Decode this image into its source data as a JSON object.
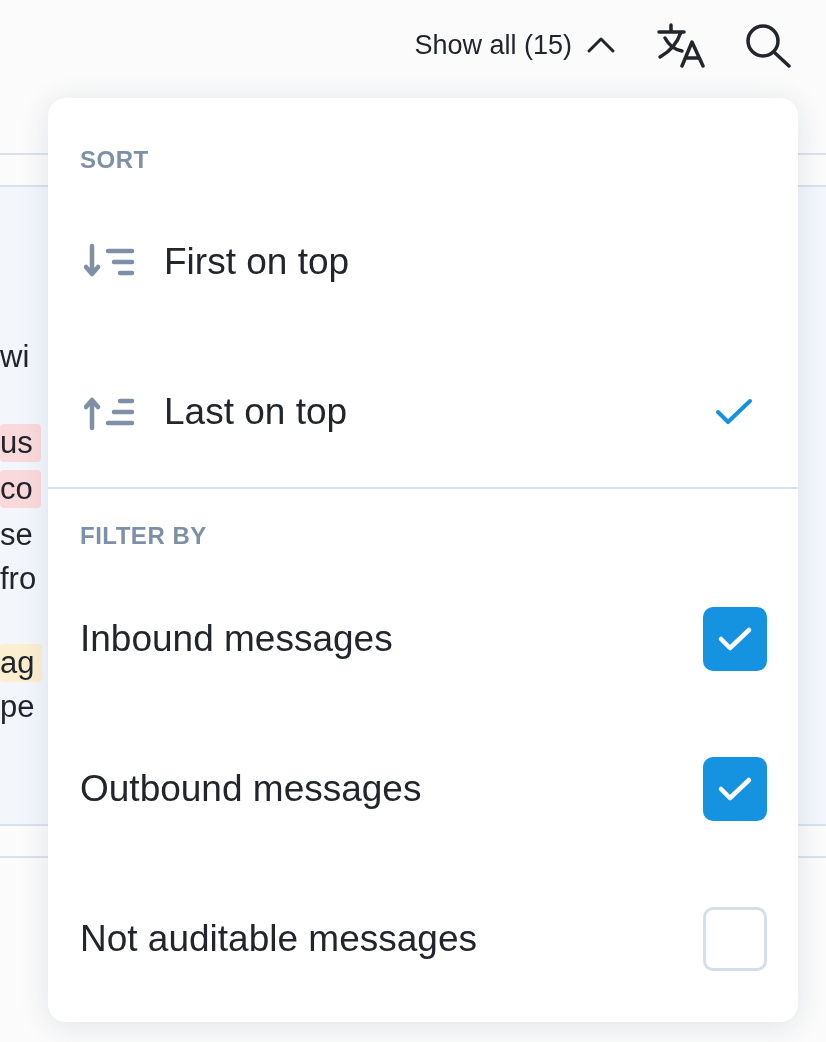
{
  "header": {
    "show_all": {
      "label": "Show all (15)",
      "expanded": true
    }
  },
  "background": {
    "fragments": [
      {
        "text": "wi",
        "kind": "plain"
      },
      {
        "text": "us",
        "kind": "tag",
        "color": "#fad9dc"
      },
      {
        "text": "co",
        "kind": "tag",
        "color": "#fad9dc"
      },
      {
        "text": "se",
        "kind": "plain"
      },
      {
        "text": "fro",
        "kind": "plain"
      },
      {
        "text": "ag",
        "kind": "tag",
        "color": "#fcefcf"
      },
      {
        "text": "pe",
        "kind": "plain"
      }
    ]
  },
  "menu": {
    "sort": {
      "heading": "SORT",
      "options": [
        {
          "label": "First on top",
          "kind": "descending",
          "selected": false
        },
        {
          "label": "Last on top",
          "kind": "ascending",
          "selected": true
        }
      ]
    },
    "filter": {
      "heading": "FILTER BY",
      "options": [
        {
          "label": "Inbound messages",
          "checked": true
        },
        {
          "label": "Outbound messages",
          "checked": true
        },
        {
          "label": "Not auditable messages",
          "checked": false
        }
      ]
    }
  }
}
